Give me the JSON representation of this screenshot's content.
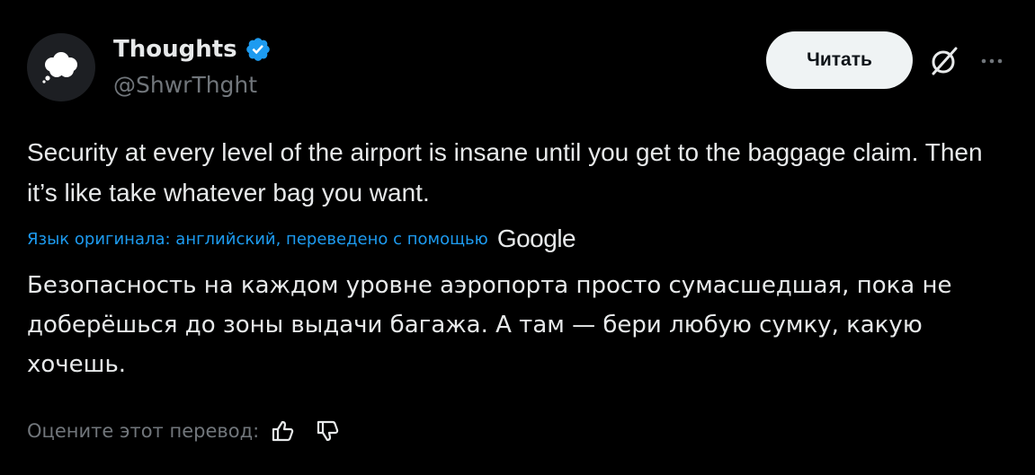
{
  "author": {
    "name": "Thoughts",
    "handle": "@ShwrThght",
    "verified": true,
    "verified_color": "#1d9bf0"
  },
  "actions": {
    "read_label": "Читать",
    "grok_icon": "grok-icon",
    "more_icon": "more-icon"
  },
  "post": {
    "original_text": "Security at every level of the airport is insane until you get to the baggage claim. Then it’s like take whatever bag you want.",
    "translation_note": "Язык оригинала: английский, переведено с помощью",
    "translation_provider": "Google",
    "translated_text": "Безопасность на каждом уровне аэропорта просто сумасшедшая, пока не доберёшься до зоны выдачи багажа. А там — бери любую сумку, какую хочешь."
  },
  "rating": {
    "label": "Оцените этот перевод:",
    "thumbs_up_icon": "thumbs-up-icon",
    "thumbs_down_icon": "thumbs-down-icon"
  },
  "colors": {
    "background": "#000000",
    "text": "#e7e9ea",
    "muted": "#71767b",
    "link": "#1d9bf0"
  }
}
